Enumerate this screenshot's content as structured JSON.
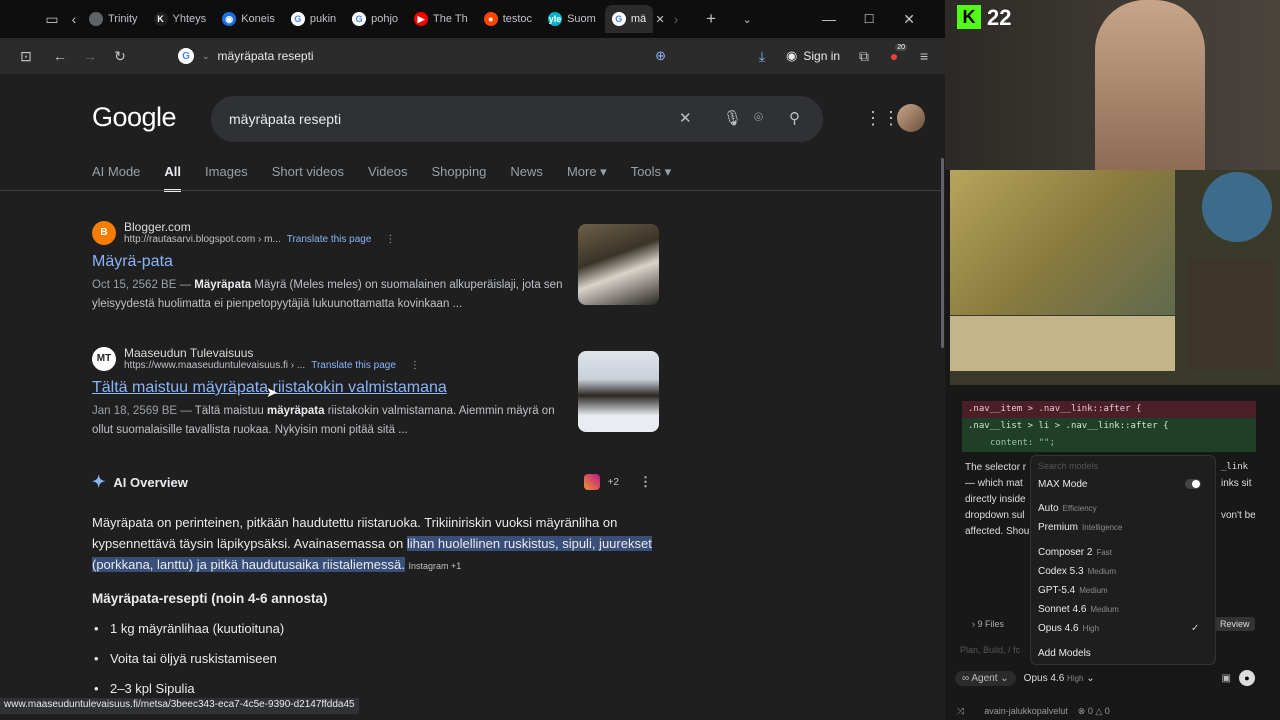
{
  "tabs": [
    {
      "label": "Trinity",
      "fav": "",
      "color": "#5f6368"
    },
    {
      "label": "Yhteys",
      "fav": "K",
      "color": "#1f1f1f"
    },
    {
      "label": "Koneis",
      "fav": "◉",
      "color": "#1a73e8"
    },
    {
      "label": "pukin",
      "fav": "G",
      "color": "#ffffff"
    },
    {
      "label": "pohjo",
      "fav": "G",
      "color": "#ffffff"
    },
    {
      "label": "The Th",
      "fav": "▶",
      "color": "#ff0000"
    },
    {
      "label": "testoc",
      "fav": "●",
      "color": "#ff4500"
    },
    {
      "label": "Suom",
      "fav": "yle",
      "color": "#00b4c8"
    },
    {
      "label": "mä",
      "fav": "G",
      "color": "#ffffff"
    }
  ],
  "toolbar": {
    "url": "mäyräpata resepti",
    "signin": "Sign in",
    "ext_badge": "20"
  },
  "search": {
    "query": "mäyräpata resepti",
    "logo": "Google"
  },
  "filters": [
    "AI Mode",
    "All",
    "Images",
    "Short videos",
    "Videos",
    "Shopping",
    "News",
    "More ▾",
    "Tools ▾"
  ],
  "results": [
    {
      "source": "Blogger.com",
      "url": "http://rautasarvi.blogspot.com › m...",
      "translate": "Translate this page",
      "title": "Mäyrä-pata",
      "date": "Oct 15, 2562 BE —",
      "bold": "Mäyräpata",
      "snippet": "Mäyrä (Meles meles) on suomalainen alkuperäislaji, jota sen yleisyydestä huolimatta ei pienpetopyytäjiä lukuunottamatta kovinkaan ..."
    },
    {
      "source": "Maaseudun Tulevaisuus",
      "url": "https://www.maaseuduntulevaisuus.fi › ...",
      "translate": "Translate this page",
      "title": "Tältä maistuu mäyräpata riistakokin valmistamana",
      "date": "Jan 18, 2569 BE —",
      "pre": "Tältä maistuu",
      "bold": "mäyräpata",
      "snippet": "riistakokin valmistamana. Aiemmin mäyrä on ollut suomalaisille tavallista ruokaa. Nykyisin moni pitää sitä ..."
    }
  ],
  "ai_overview": {
    "heading": "AI Overview",
    "badge": "+2",
    "text_plain": "Mäyräpata on perinteinen, pitkään haudutettu riistaruoka. Trikiiniriskin vuoksi mäyränliha on kypsennettävä täysin läpikypsäksi. Avainasemassa on",
    "text_highlight": "lihan huolellinen ruskistus, sipuli, juurekset (porkkana, lanttu) ja pitkä haudutusaika riistaliemessä.",
    "source_chip": "Instagram +1",
    "subheading": "Mäyräpata-resepti (noin 4-6 annosta)",
    "bullets": [
      "1 kg mäyränlihaa (kuutioituna)",
      "Voita tai öljyä ruskistamiseen",
      "2–3 kpl Sipulia"
    ]
  },
  "status_url": "www.maaseuduntulevaisuus.fi/metsa/3beec343-eca7-4c5e-9390-d2147ffdda45",
  "overlay": {
    "counter": "22"
  },
  "editor": {
    "code_lines": [
      ".nav__item > .nav__link::after {",
      ".nav__list > li > .nav__link::after {",
      "content: \"\";"
    ],
    "fragments": [
      "The selector r",
      "— which mat",
      "directly inside",
      "dropdown sul",
      "affected. Shou",
      "_link",
      "inks sit",
      "von't be"
    ],
    "search_models": "Search models",
    "max_mode": "MAX Mode",
    "auto": "Auto",
    "auto_sub": "Efficiency",
    "premium": "Premium",
    "premium_sub": "Intelligence",
    "models": [
      {
        "name": "Composer 2",
        "sub": "Fast"
      },
      {
        "name": "Codex 5.3",
        "sub": "Medium"
      },
      {
        "name": "GPT-5.4",
        "sub": "Medium"
      },
      {
        "name": "Sonnet 4.6",
        "sub": "Medium"
      },
      {
        "name": "Opus 4.6",
        "sub": "High"
      }
    ],
    "add_models": "Add Models",
    "files": "9 Files",
    "review": "Review",
    "plan_placeholder": "Plan, Build, / fc",
    "agent": "Agent",
    "selected_model": "Opus 4.6",
    "selected_sub": "High",
    "status_branch": "avain-jalukkopalvelut",
    "status_errors": "0",
    "status_warnings": "0"
  }
}
